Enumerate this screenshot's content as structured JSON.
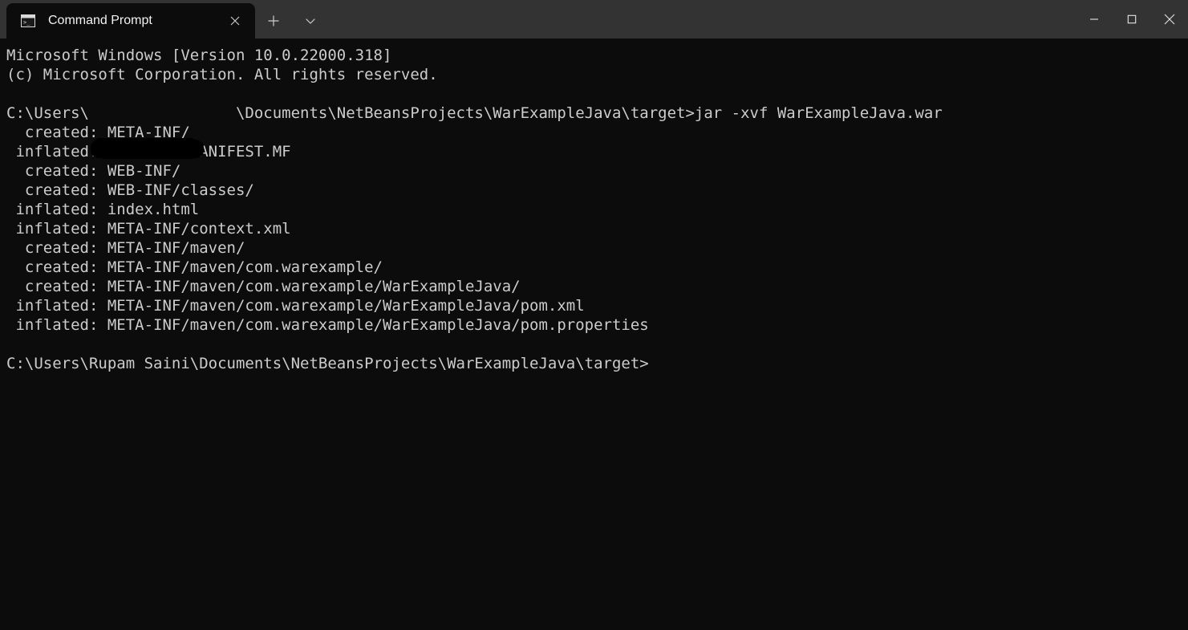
{
  "window": {
    "titlebar_color": "#333333",
    "tab_color": "#0c0c0c",
    "terminal_bg": "#0c0c0c",
    "terminal_fg": "#cccccc"
  },
  "tab": {
    "title": "Command Prompt",
    "icon": "command-prompt-icon",
    "close_icon": "close-icon"
  },
  "tabbar": {
    "new_tab_icon": "plus-icon",
    "dropdown_icon": "chevron-down-icon"
  },
  "window_controls": {
    "minimize_icon": "minimize-icon",
    "maximize_icon": "maximize-icon",
    "close_icon": "close-icon"
  },
  "terminal": {
    "lines": [
      "Microsoft Windows [Version 10.0.22000.318]",
      "(c) Microsoft Corporation. All rights reserved.",
      "",
      "C:\\Users\\                \\Documents\\NetBeansProjects\\WarExampleJava\\target>jar -xvf WarExampleJava.war",
      "  created: META-INF/",
      " inflated: META-INF/MANIFEST.MF",
      "  created: WEB-INF/",
      "  created: WEB-INF/classes/",
      " inflated: index.html",
      " inflated: META-INF/context.xml",
      "  created: META-INF/maven/",
      "  created: META-INF/maven/com.warexample/",
      "  created: META-INF/maven/com.warexample/WarExampleJava/",
      " inflated: META-INF/maven/com.warexample/WarExampleJava/pom.xml",
      " inflated: META-INF/maven/com.warexample/WarExampleJava/pom.properties",
      "",
      "C:\\Users\\Rupam Saini\\Documents\\NetBeansProjects\\WarExampleJava\\target>"
    ]
  }
}
